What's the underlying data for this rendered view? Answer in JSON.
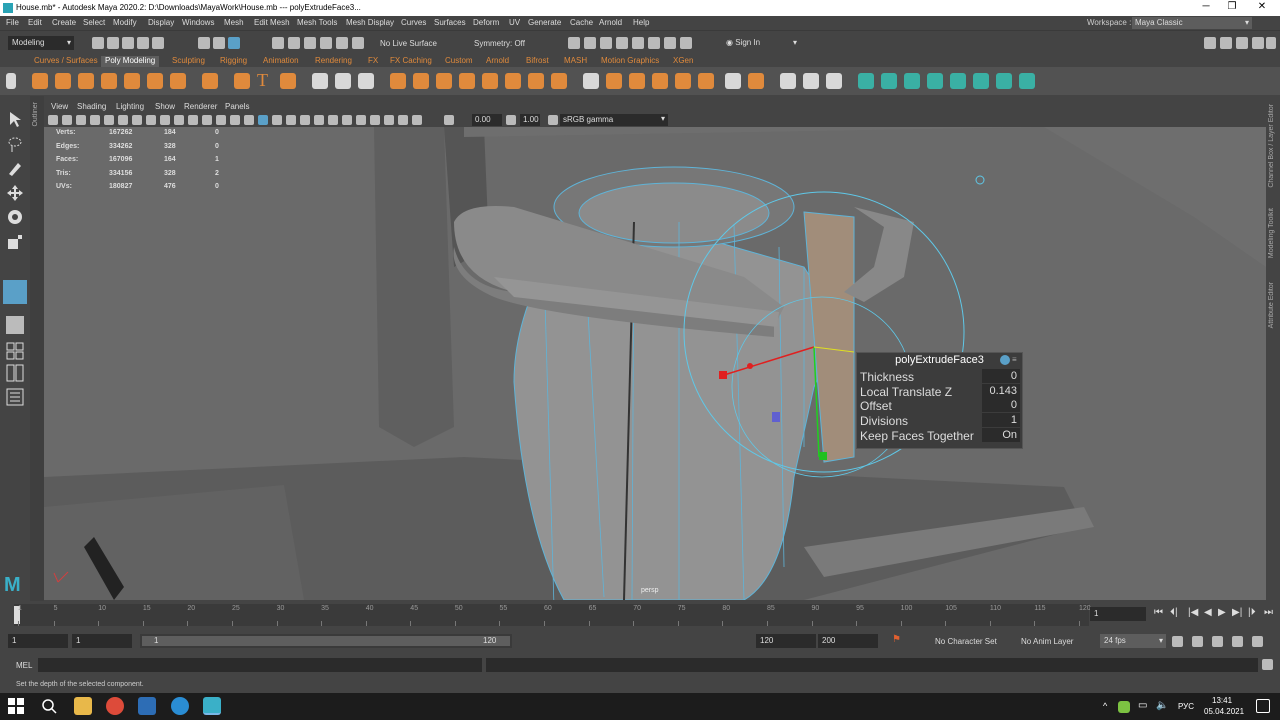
{
  "window": {
    "title": "House.mb* - Autodesk Maya 2020.2: D:\\Downloads\\MayaWork\\House.mb  ---  polyExtrudeFace3..."
  },
  "menubar": {
    "items": [
      "File",
      "Edit",
      "Create",
      "Select",
      "Modify",
      "Display",
      "Windows",
      "Mesh",
      "Edit Mesh",
      "Mesh Tools",
      "Mesh Display",
      "Curves",
      "Surfaces",
      "Deform",
      "UV",
      "Generate",
      "Cache",
      "Arnold",
      "Help"
    ],
    "workspace_label": "Workspace :",
    "workspace_value": "Maya Classic"
  },
  "statusline": {
    "mode": "Modeling",
    "live_surface": "No Live Surface",
    "symmetry": "Symmetry: Off",
    "sign_in": "Sign In"
  },
  "shelf": {
    "tabs": [
      "Curves / Surfaces",
      "Poly Modeling",
      "Sculpting",
      "Rigging",
      "Animation",
      "Rendering",
      "FX",
      "FX Caching",
      "Custom",
      "Arnold",
      "Bifrost",
      "MASH",
      "Motion Graphics",
      "XGen"
    ],
    "active_tab": "Poly Modeling"
  },
  "panel_menu": [
    "View",
    "Shading",
    "Lighting",
    "Show",
    "Renderer",
    "Panels"
  ],
  "view_toolbar": {
    "exposure": "0.00",
    "gamma": "1.00",
    "color_space": "sRGB gamma"
  },
  "hud": {
    "rows": [
      {
        "label": "Verts:",
        "total": "167262",
        "selected": "184",
        "components": "0"
      },
      {
        "label": "Edges:",
        "total": "334262",
        "selected": "328",
        "components": "0"
      },
      {
        "label": "Faces:",
        "total": "167096",
        "selected": "164",
        "components": "1"
      },
      {
        "label": "Tris:",
        "total": "334156",
        "selected": "328",
        "components": "2"
      },
      {
        "label": "UVs:",
        "total": "180827",
        "selected": "476",
        "components": "0"
      }
    ],
    "camera": "persp"
  },
  "extrude_panel": {
    "title": "polyExtrudeFace3",
    "fields": [
      {
        "label": "Thickness",
        "value": "0"
      },
      {
        "label": "Local Translate Z",
        "value": "0.143"
      },
      {
        "label": "Offset",
        "value": "0"
      },
      {
        "label": "Divisions",
        "value": "1"
      },
      {
        "label": "Keep Faces Together",
        "value": "On"
      }
    ]
  },
  "right_strip": [
    "Channel Box / Layer Editor",
    "Modeling Toolkit",
    "Attribute Editor"
  ],
  "left_strip": "Outliner",
  "timeslider": {
    "ticks": [
      "1",
      "5",
      "10",
      "15",
      "20",
      "25",
      "30",
      "35",
      "40",
      "45",
      "50",
      "55",
      "60",
      "65",
      "70",
      "75",
      "80",
      "85",
      "90",
      "95",
      "100",
      "105",
      "110",
      "115",
      "120"
    ],
    "current_frame": "1"
  },
  "range": {
    "start": "1",
    "start_inner": "1",
    "range_start_label": "1",
    "range_end_label": "120",
    "end_inner": "120",
    "end": "200",
    "character_set": "No Character Set",
    "anim_layer": "No Anim Layer",
    "fps": "24 fps"
  },
  "cmdline": {
    "label": "MEL"
  },
  "helpline": {
    "text": "Set the depth of the selected component."
  },
  "taskbar": {
    "lang": "РУС",
    "time": "13:41",
    "date": "05.04.2021"
  }
}
